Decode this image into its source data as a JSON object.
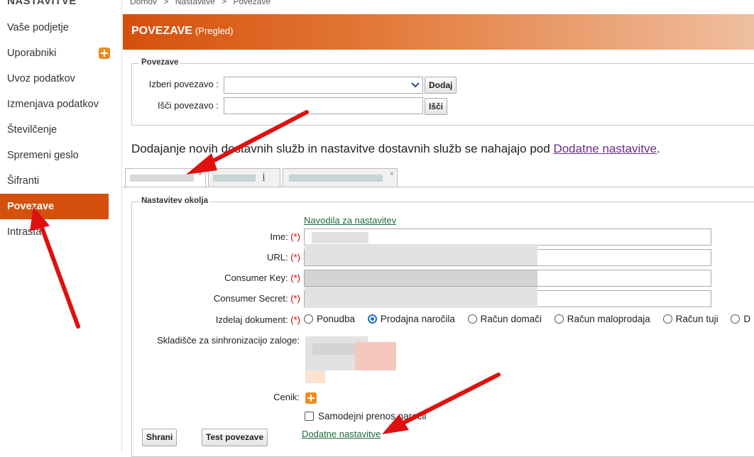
{
  "sidebar": {
    "title": "NASTAVITVE",
    "items": [
      {
        "label": "Vaše podjetje"
      },
      {
        "label": "Uporabniki"
      },
      {
        "label": "Uvoz podatkov"
      },
      {
        "label": "Izmenjava podatkov"
      },
      {
        "label": "Številčenje"
      },
      {
        "label": "Spremeni geslo"
      },
      {
        "label": "Šifranti"
      },
      {
        "label": "Povezave"
      },
      {
        "label": "Intrastat"
      }
    ],
    "active_index": 7
  },
  "breadcrumb": [
    "Domov",
    ">",
    "Nastavitve",
    ">",
    "Povezave"
  ],
  "header": {
    "title": "POVEZAVE",
    "subtitle": "(Pregled)"
  },
  "connections": {
    "legend": "Povezave",
    "select_label": "Izberi povezavo :",
    "add_button": "Dodaj",
    "search_label": "Išči povezavo :",
    "search_button": "Išči"
  },
  "info": {
    "text": "Dodajanje novih dostavnih služb in nastavitve dostavnih služb se nahajajo pod ",
    "link": "Dodatne nastavitve",
    "end": "."
  },
  "tabs": {
    "close_glyph": "×",
    "second_suffix": "i"
  },
  "environment": {
    "legend": "Nastavitev okolja",
    "guide_link": "Navodila za nastavitev",
    "required_mark": "(*)",
    "fields": [
      {
        "label": "Ime:"
      },
      {
        "label": "URL:"
      },
      {
        "label": "Consumer Key:"
      },
      {
        "label": "Consumer Secret:"
      }
    ],
    "document_label": "Izdelaj dokument:",
    "document_options": [
      "Ponudba",
      "Prodajna naročila",
      "Račun domači",
      "Račun maloprodaja",
      "Račun tuji",
      "D"
    ],
    "document_selected": "Prodajna naročila",
    "warehouse_label": "Skladišče za sinhronizacijo zaloge:",
    "pricelist_label": "Cenik:",
    "auto_transfer_label": "Samodejni prenos naročil",
    "auto_transfer_checked": false,
    "additional_link": "Dodatne nastavitve",
    "save_button": "Shrani",
    "test_button": "Test povezave"
  },
  "colors": {
    "accent": "#d4500c",
    "arrow": "#e01010",
    "link": "#1e6a3a",
    "info_link": "#6a2c8a"
  }
}
